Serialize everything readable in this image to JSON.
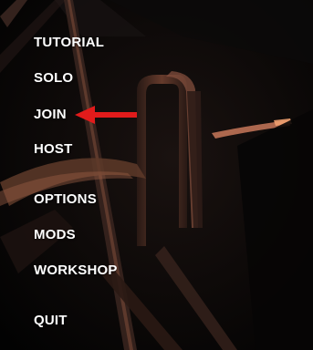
{
  "menu": {
    "tutorial": "TUTORIAL",
    "solo": "SOLO",
    "join": "JOIN",
    "host": "HOST",
    "options": "OPTIONS",
    "mods": "MODS",
    "workshop": "WORKSHOP",
    "quit": "QUIT"
  },
  "annotation": {
    "icon": "red-arrow-icon",
    "color": "#e11b1b"
  },
  "colors": {
    "menu_text": "#ffffff",
    "background": "#030303",
    "scene_highlight": "#c8785a"
  }
}
